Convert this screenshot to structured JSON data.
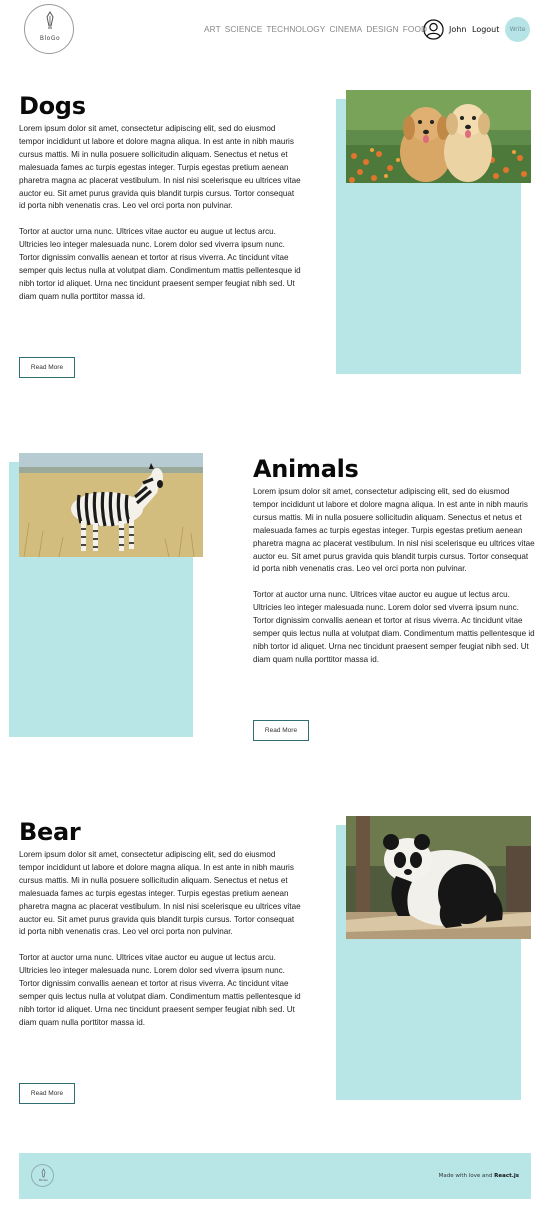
{
  "header": {
    "logo_text": "BloGo",
    "nav": [
      "ART",
      "SCIENCE",
      "TECHNOLOGY",
      "CINEMA",
      "DESIGN",
      "FOOD"
    ],
    "username": "John",
    "logout_label": "Logout",
    "write_label": "Write",
    "icons": {
      "logo": "quill-pen-icon",
      "user": "user-profile-icon"
    }
  },
  "posts": [
    {
      "title": "Dogs",
      "image": "puppies-photo",
      "paragraph1": "Lorem ipsum dolor sit amet, consectetur adipiscing elit, sed do eiusmod tempor incididunt ut labore et dolore magna aliqua. In est ante in nibh mauris cursus mattis. Mi in nulla posuere sollicitudin aliquam. Senectus et netus et malesuada fames ac turpis egestas integer. Turpis egestas pretium aenean pharetra magna ac placerat vestibulum. In nisl nisi scelerisque eu ultrices vitae auctor eu. Sit amet purus gravida quis blandit turpis cursus. Tortor consequat id porta nibh venenatis cras. Leo vel orci porta non pulvinar.",
      "paragraph2": "Tortor at auctor urna nunc. Ultrices vitae auctor eu augue ut lectus arcu. Ultricies leo integer malesuada nunc. Lorem dolor sed viverra ipsum nunc. Tortor dignissim convallis aenean et tortor at risus viverra. Ac tincidunt vitae semper quis lectus nulla at volutpat diam. Condimentum mattis pellentesque id nibh tortor id aliquet. Urna nec tincidunt praesent semper feugiat nibh sed. Ut diam quam nulla porttitor massa id.",
      "read_more": "Read More"
    },
    {
      "title": "Animals",
      "image": "zebra-photo",
      "paragraph1": "Lorem ipsum dolor sit amet, consectetur adipiscing elit, sed do eiusmod tempor incididunt ut labore et dolore magna aliqua. In est ante in nibh mauris cursus mattis. Mi in nulla posuere sollicitudin aliquam. Senectus et netus et malesuada fames ac turpis egestas integer. Turpis egestas pretium aenean pharetra magna ac placerat vestibulum. In nisl nisi scelerisque eu ultrices vitae auctor eu. Sit amet purus gravida quis blandit turpis cursus. Tortor consequat id porta nibh venenatis cras. Leo vel orci porta non pulvinar.",
      "paragraph2": "Tortor at auctor urna nunc. Ultrices vitae auctor eu augue ut lectus arcu. Ultricies leo integer malesuada nunc. Lorem dolor sed viverra ipsum nunc. Tortor dignissim convallis aenean et tortor at risus viverra. Ac tincidunt vitae semper quis lectus nulla at volutpat diam. Condimentum mattis pellentesque id nibh tortor id aliquet. Urna nec tincidunt praesent semper feugiat nibh sed. Ut diam quam nulla porttitor massa id.",
      "read_more": "Read More"
    },
    {
      "title": "Bear",
      "image": "panda-photo",
      "paragraph1": "Lorem ipsum dolor sit amet, consectetur adipiscing elit, sed do eiusmod tempor incididunt ut labore et dolore magna aliqua. In est ante in nibh mauris cursus mattis. Mi in nulla posuere sollicitudin aliquam. Senectus et netus et malesuada fames ac turpis egestas integer. Turpis egestas pretium aenean pharetra magna ac placerat vestibulum. In nisl nisi scelerisque eu ultrices vitae auctor eu. Sit amet purus gravida quis blandit turpis cursus. Tortor consequat id porta nibh venenatis cras. Leo vel orci porta non pulvinar.",
      "paragraph2": "Tortor at auctor urna nunc. Ultrices vitae auctor eu augue ut lectus arcu. Ultricies leo integer malesuada nunc. Lorem dolor sed viverra ipsum nunc. Tortor dignissim convallis aenean et tortor at risus viverra. Ac tincidunt vitae semper quis lectus nulla at volutpat diam. Condimentum mattis pellentesque id nibh tortor id aliquet. Urna nec tincidunt praesent semper feugiat nibh sed. Ut diam quam nulla porttitor massa id.",
      "read_more": "Read More"
    }
  ],
  "footer": {
    "logo_text": "BloGo",
    "note_prefix": "Made with love and ",
    "note_brand": "React.js"
  },
  "colors": {
    "accent": "#b8e5e6",
    "button_border": "#2f6f73"
  }
}
